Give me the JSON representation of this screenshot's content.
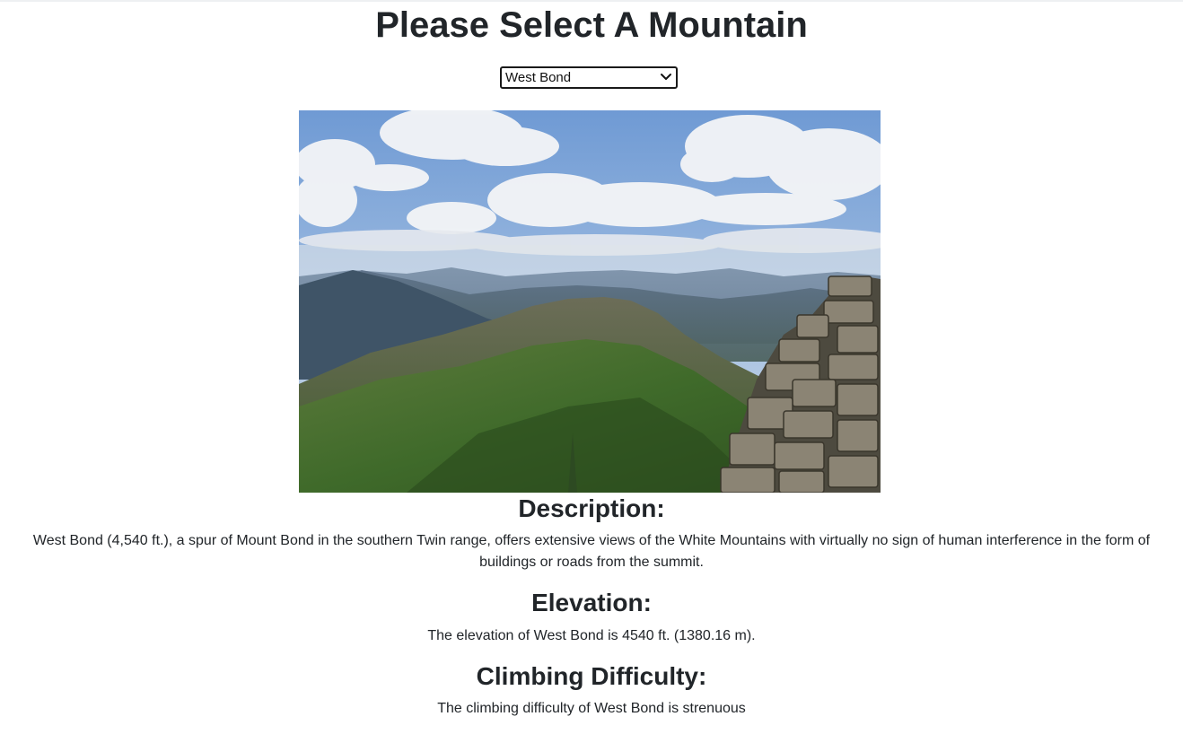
{
  "page": {
    "title": "Please Select A Mountain"
  },
  "selector": {
    "selected": "West Bond"
  },
  "photo": {
    "alt": "West Bond"
  },
  "description": {
    "heading": "Description:",
    "text": "West Bond (4,540 ft.), a spur of Mount Bond in the southern Twin range, offers extensive views of the White Mountains with virtually no sign of human interference in the form of buildings or roads from the summit."
  },
  "elevation": {
    "heading": "Elevation:",
    "text": "The elevation of West Bond is 4540 ft. (1380.16 m)."
  },
  "difficulty": {
    "heading": "Climbing Difficulty:",
    "text": "The climbing difficulty of West Bond is strenuous"
  },
  "colors": {
    "text": "#212529",
    "background": "#ffffff",
    "select_border": "#1a1a1a"
  }
}
